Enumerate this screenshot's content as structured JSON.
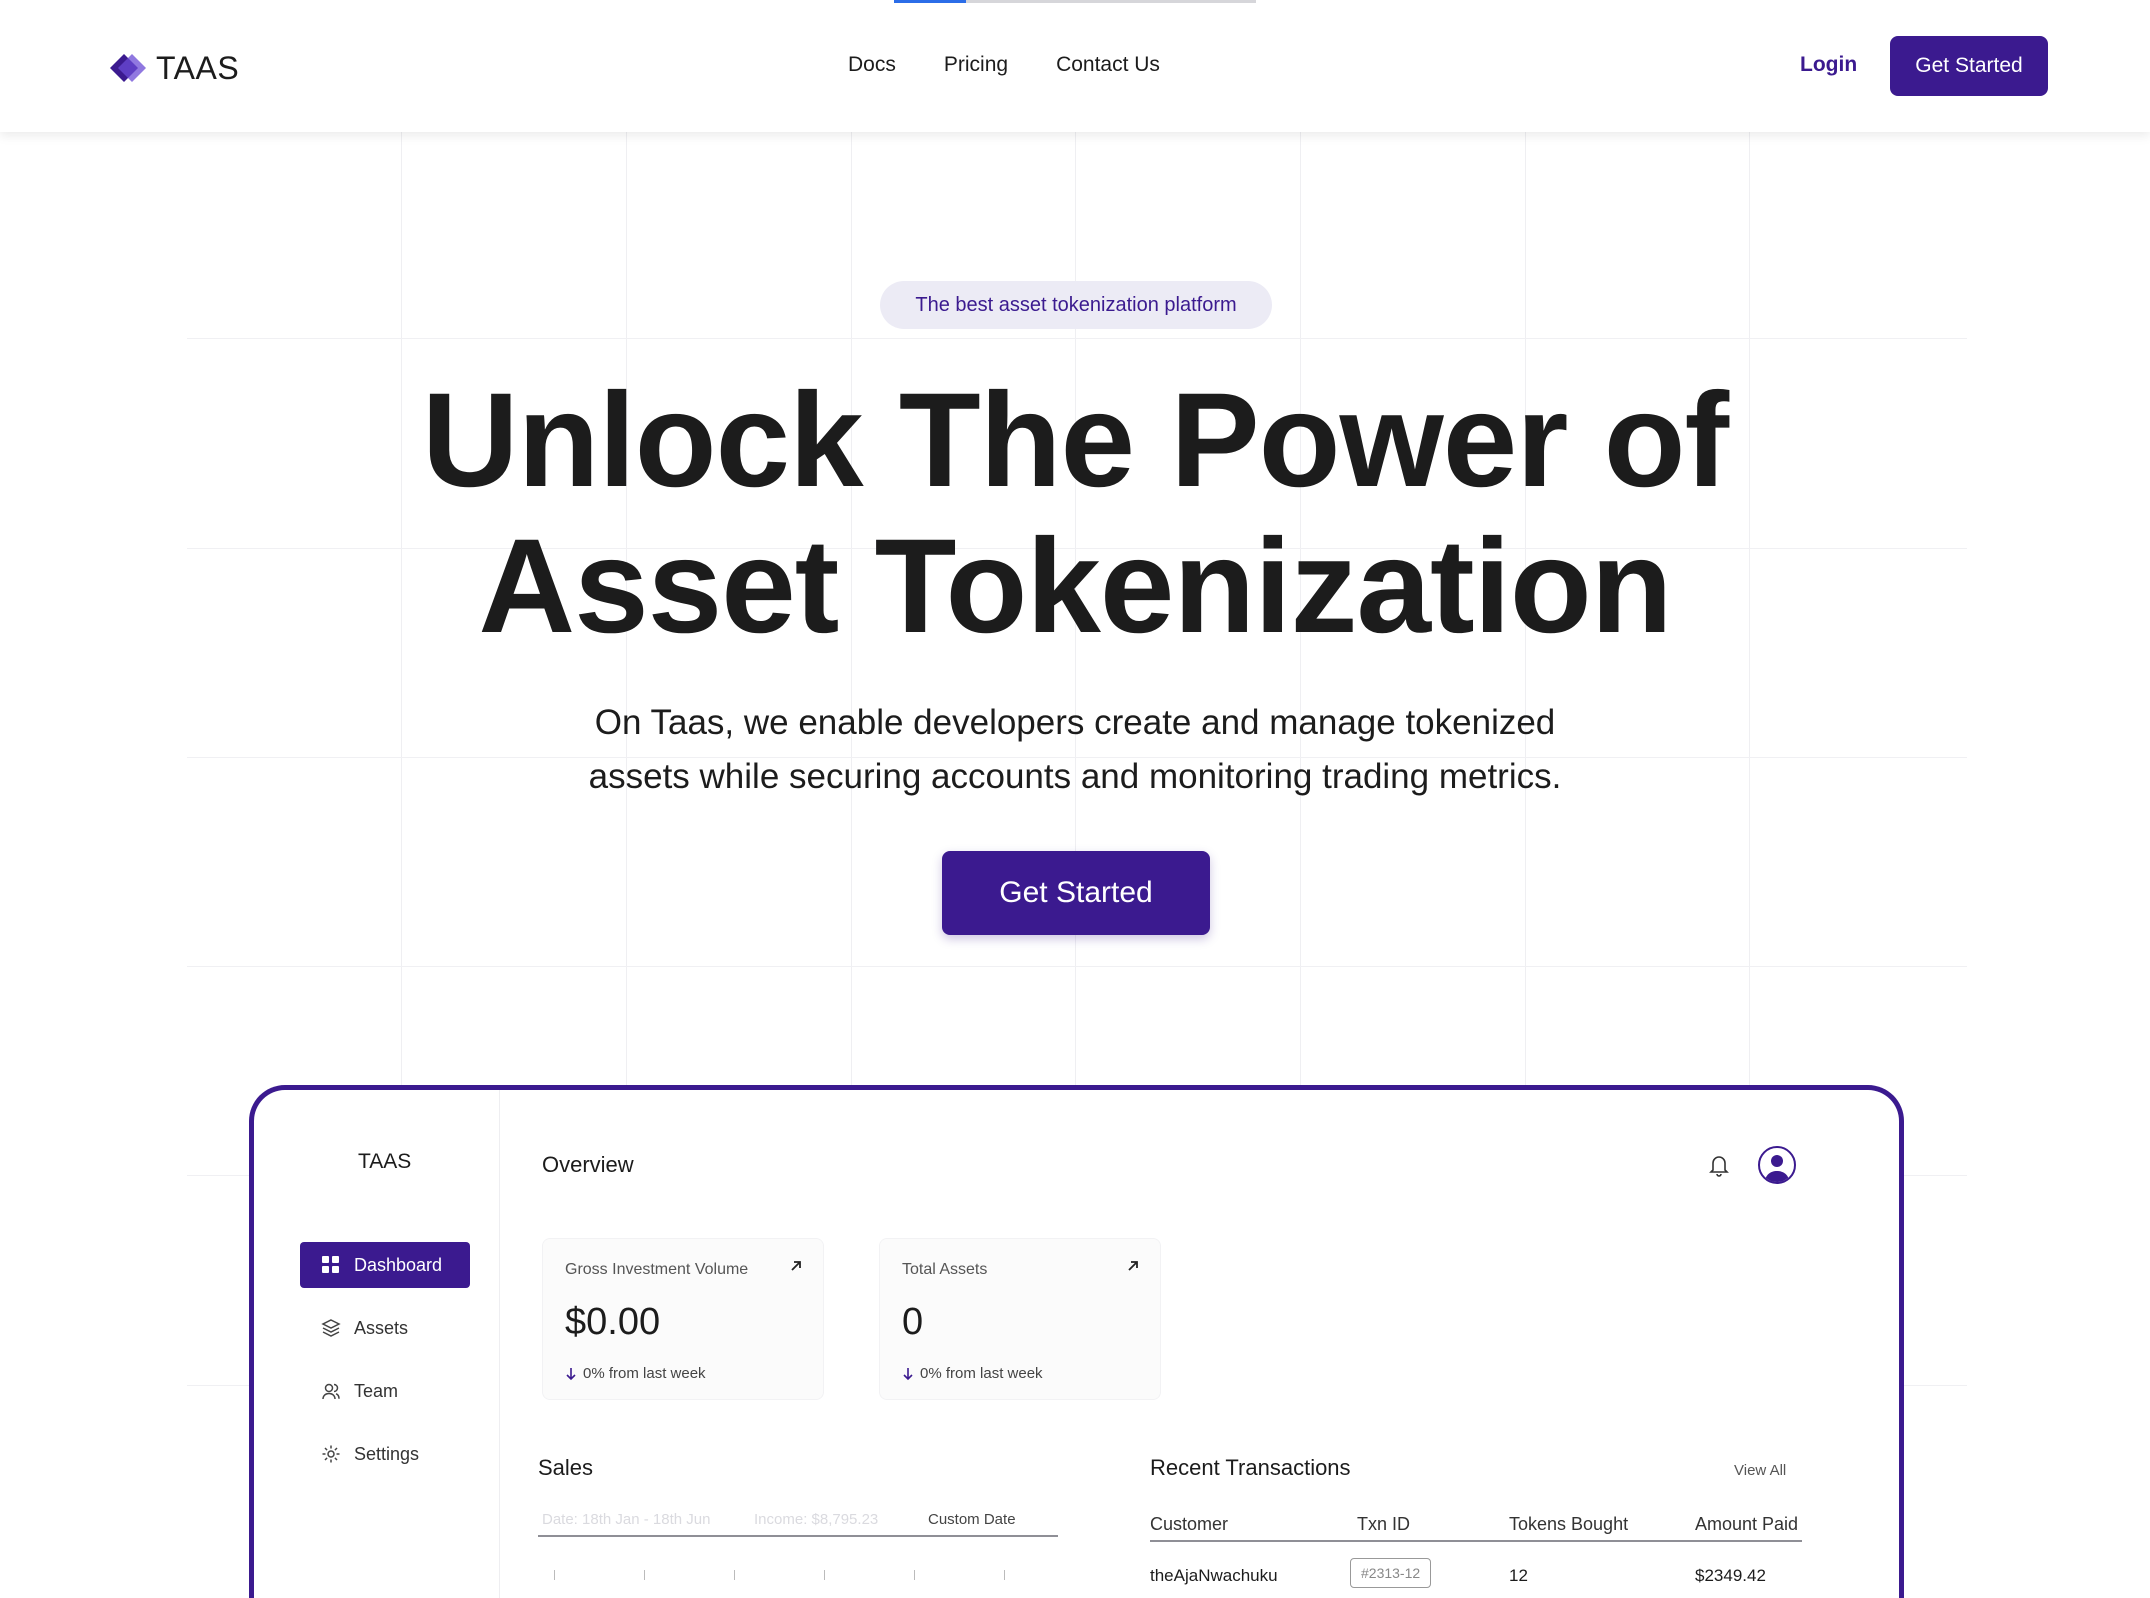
{
  "nav": {
    "logo_text": "TAAS",
    "links": [
      "Docs",
      "Pricing",
      "Contact Us"
    ],
    "login": "Login",
    "cta": "Get Started"
  },
  "hero": {
    "pill": "The best asset tokenization platform",
    "title_line1": "Unlock The Power of",
    "title_line2": "Asset Tokenization",
    "subtitle_line1": "On Taas, we enable developers create and manage tokenized",
    "subtitle_line2": "assets while securing accounts and monitoring trading metrics.",
    "cta": "Get Started"
  },
  "dashboard": {
    "logo": "TAAS",
    "title": "Overview",
    "sidebar": [
      {
        "label": "Dashboard",
        "icon": "grid-icon",
        "active": true
      },
      {
        "label": "Assets",
        "icon": "layers-icon",
        "active": false
      },
      {
        "label": "Team",
        "icon": "users-icon",
        "active": false
      },
      {
        "label": "Settings",
        "icon": "gear-icon",
        "active": false
      }
    ],
    "cards": [
      {
        "label": "Gross Investment Volume",
        "value": "$0.00",
        "delta": "0% from last week"
      },
      {
        "label": "Total Assets",
        "value": "0",
        "delta": "0% from last week"
      }
    ],
    "sales": {
      "title": "Sales",
      "filters": [
        "Date: 18th Jan - 18th Jun",
        "Income: $8,795.23",
        "Custom Date"
      ]
    },
    "transactions": {
      "title": "Recent Transactions",
      "view_all": "View All",
      "columns": [
        "Customer",
        "Txn ID",
        "Tokens Bought",
        "Amount Paid"
      ],
      "rows": [
        {
          "customer": "theAjaNwachuku",
          "txn_id": "#2313-12",
          "tokens": "12",
          "amount": "$2349.42"
        }
      ]
    }
  },
  "colors": {
    "brand": "#3b1a8f",
    "pill_bg": "#ecebf5",
    "text": "#1c1c1c"
  }
}
